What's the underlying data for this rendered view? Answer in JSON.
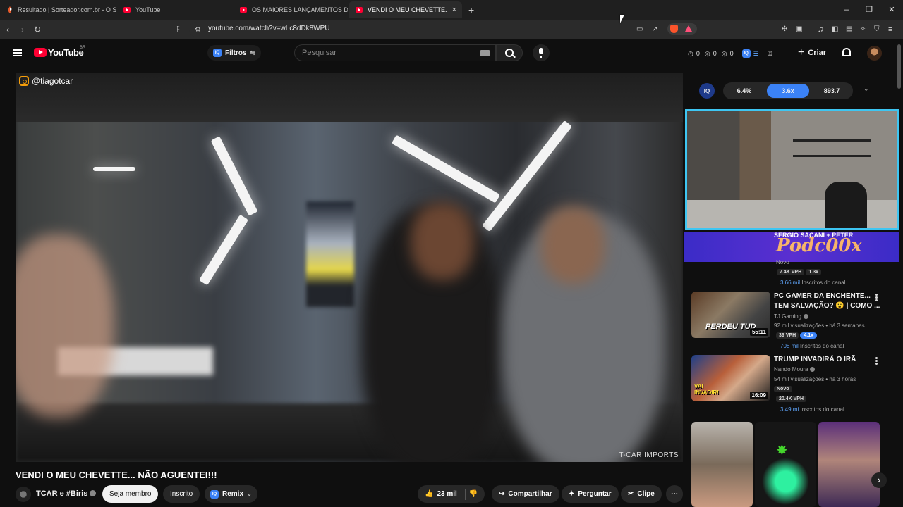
{
  "browser": {
    "tabs": [
      {
        "title": "Resultado | Sorteador.com.br - O Site",
        "active": false
      },
      {
        "title": "YouTube",
        "active": false
      },
      {
        "title": "OS MAIORES LANÇAMENTOS DO CI",
        "active": false
      },
      {
        "title": "VENDI O MEU CHEVETTE... NÃO",
        "active": true
      }
    ],
    "url": "youtube.com/watch?v=wLc8dDk8WPU",
    "new_tab": "+",
    "close_tab": "×",
    "win_min": "–",
    "win_max": "❐",
    "win_close": "✕"
  },
  "header": {
    "logo_text": "YouTube",
    "country": "BR",
    "filters_label": "Filtros",
    "iq_label": "IQ",
    "search_placeholder": "Pesquisar",
    "stats": [
      "0",
      "0",
      "0"
    ],
    "create_label": "Criar"
  },
  "video": {
    "watermark_handle": "@tiagotcar",
    "watermark_brand": "T-CAR IMPORTS",
    "title": "VENDI O MEU CHEVETTE... NÃO AGUENTEI!!!",
    "channel": "TCAR e #Biris",
    "member_btn": "Seja membro",
    "subscribed_btn": "Inscrito",
    "remix_btn": "Remix",
    "likes": "23 mil",
    "share_btn": "Compartilhar",
    "ask_btn": "Perguntar",
    "clip_btn": "Clipe",
    "more": "⋯"
  },
  "iq_panel": {
    "logo": "IQ",
    "values": [
      "6.4%",
      "3.6x",
      "893.7"
    ],
    "active_index": 1
  },
  "sidebar": {
    "banner_title": "SERGIO SACANI + PETER",
    "banner_text": "Podc00x",
    "item0": {
      "status": "Novo",
      "vph": "7.4K VPH",
      "mult": "1.3x",
      "subs": "3,66 mil",
      "subs_label": "Inscritos do canal"
    },
    "items": [
      {
        "title_line1": "PC GAMER DA ENCHENTE...",
        "title_line2": "TEM SALVAÇÃO? 😮 | COMO ...",
        "channel": "TJ Gaming",
        "views": "92 mil visualizações • há 3 semanas",
        "vph": "39 VPH",
        "mult": "4.1x",
        "subs": "708 mil",
        "subs_label": "Inscritos do canal",
        "duration": "55:11",
        "thumb_text": "PERDEU TUD"
      },
      {
        "title_line1": "TRUMP INVADIRÁ O IRÃ",
        "channel": "Nando Moura",
        "views": "54 mil visualizações • há 3 horas",
        "status": "Novo",
        "vph": "20.4K VPH",
        "subs": "3,49 mi",
        "subs_label": "Inscritos do canal",
        "duration": "16:09",
        "thumb_text": "VAI INVADIR!"
      }
    ],
    "shorts_next": "›"
  },
  "colors": {
    "accent": "#3b82f6",
    "youtube_red": "#ff0033",
    "cam_border": "#3ec6f2"
  }
}
